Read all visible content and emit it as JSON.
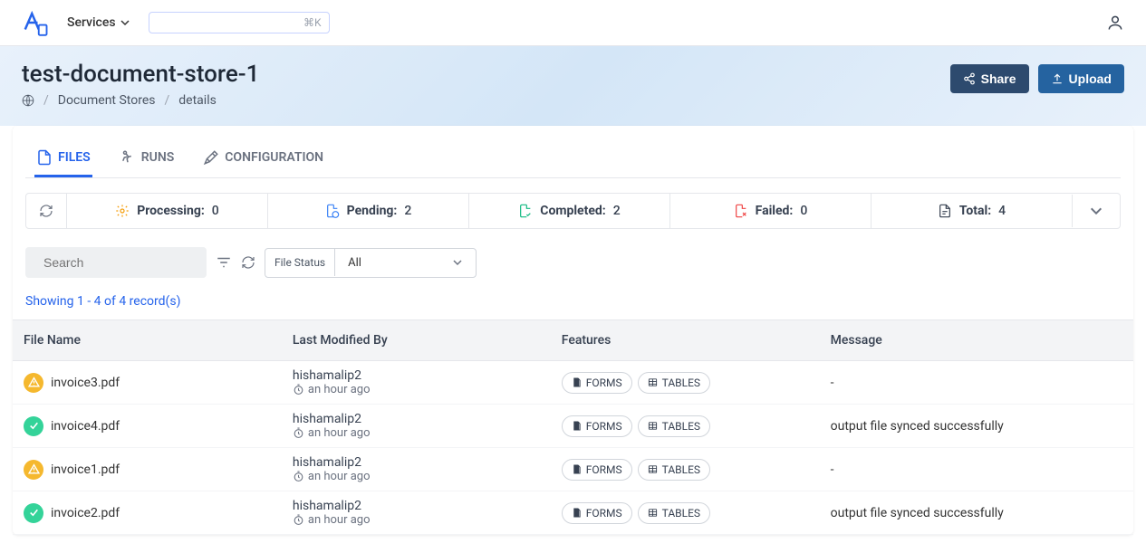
{
  "topbar": {
    "services_label": "Services",
    "cmd_hint": "⌘K"
  },
  "page": {
    "title": "test-document-store-1",
    "breadcrumb": {
      "level1": "Document Stores",
      "level2": "details"
    },
    "actions": {
      "share": "Share",
      "upload": "Upload"
    }
  },
  "tabs": {
    "files": "FILES",
    "runs": "RUNS",
    "configuration": "CONFIGURATION"
  },
  "stats": {
    "processing_label": "Processing:",
    "processing_val": "0",
    "pending_label": "Pending:",
    "pending_val": "2",
    "completed_label": "Completed:",
    "completed_val": "2",
    "failed_label": "Failed:",
    "failed_val": "0",
    "total_label": "Total:",
    "total_val": "4"
  },
  "filters": {
    "search_placeholder": "Search",
    "status_label": "File Status",
    "status_value": "All"
  },
  "records_text": "Showing 1 - 4 of 4 record(s)",
  "table": {
    "headers": {
      "file_name": "File Name",
      "last_modified_by": "Last Modified By",
      "features": "Features",
      "message": "Message"
    },
    "feature_forms": "FORMS",
    "feature_tables": "TABLES",
    "rows": [
      {
        "status": "warn",
        "name": "invoice3.pdf",
        "who": "hishamalip2",
        "when": "an hour ago",
        "message": "-"
      },
      {
        "status": "ok",
        "name": "invoice4.pdf",
        "who": "hishamalip2",
        "when": "an hour ago",
        "message": "output file synced successfully"
      },
      {
        "status": "warn",
        "name": "invoice1.pdf",
        "who": "hishamalip2",
        "when": "an hour ago",
        "message": "-"
      },
      {
        "status": "ok",
        "name": "invoice2.pdf",
        "who": "hishamalip2",
        "when": "an hour ago",
        "message": "output file synced successfully"
      }
    ]
  }
}
